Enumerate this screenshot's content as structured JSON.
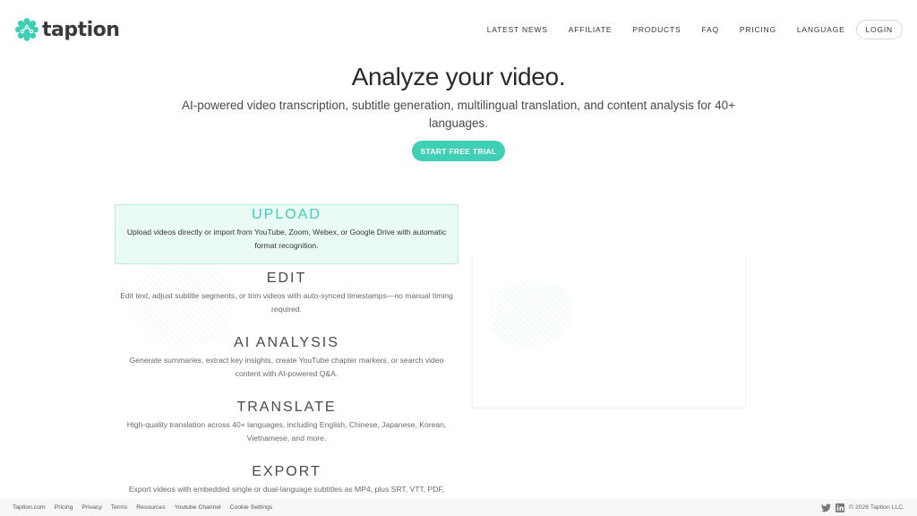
{
  "header": {
    "logo_text": "taption",
    "brand_color": "#3fcfb4",
    "nav": [
      {
        "label": "LATEST NEWS"
      },
      {
        "label": "AFFILIATE"
      },
      {
        "label": "PRODUCTS"
      },
      {
        "label": "FAQ"
      },
      {
        "label": "PRICING"
      },
      {
        "label": "LANGUAGE"
      }
    ],
    "login_label": "LOGIN"
  },
  "hero": {
    "title": "Analyze your video.",
    "subtitle": "AI-powered video transcription, subtitle generation, multilingual translation, and content analysis for 40+ languages.",
    "cta_label": "START FREE TRIAL"
  },
  "features": [
    {
      "title": "UPLOAD",
      "desc": "Upload videos directly or import from YouTube, Zoom, Webex, or Google Drive with automatic format recognition.",
      "active": true
    },
    {
      "title": "EDIT",
      "desc": "Edit text, adjust subtitle segments, or trim videos with auto-synced timestamps—no manual timing required.",
      "active": false
    },
    {
      "title": "AI ANALYSIS",
      "desc": "Generate summaries, extract key insights, create YouTube chapter markers, or search video content with AI-powered Q&A.",
      "active": false
    },
    {
      "title": "TRANSLATE",
      "desc": "High-quality translation across 40+ languages, including English, Chinese, Japanese, Korean, Vietnamese, and more.",
      "active": false
    },
    {
      "title": "EXPORT",
      "desc": "Export videos with embedded single or dual-language subtitles as MP4, plus SRT, VTT, PDF,",
      "active": false
    }
  ],
  "footer": {
    "links": [
      {
        "label": "Taption.com"
      },
      {
        "label": "Pricing"
      },
      {
        "label": "Privacy"
      },
      {
        "label": "Terms"
      },
      {
        "label": "Resources"
      },
      {
        "label": "Youtube Channel"
      },
      {
        "label": "Cookie Settings"
      }
    ],
    "copyright": "© 2026 Taption LLC.",
    "social_icons": [
      "twitter-icon",
      "linkedin-icon"
    ]
  }
}
